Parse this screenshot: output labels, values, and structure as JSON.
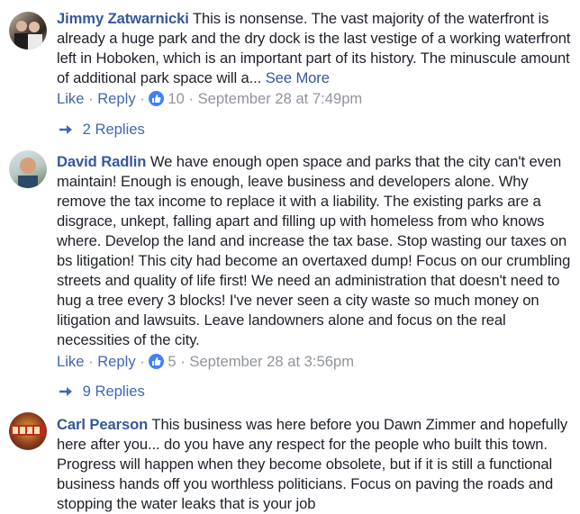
{
  "comments": [
    {
      "author": "Jimmy Zatwarnicki",
      "text": "This is nonsense. The vast majority of the waterfront is already a huge park and the dry dock is the last vestige of a working waterfront left in Hoboken, which is an important part of its history. The minuscule amount of additional park space will a...",
      "see_more": "See More",
      "like_label": "Like",
      "reply_label": "Reply",
      "reactions": "10",
      "timestamp": "September 28 at 7:49pm",
      "replies_label": "2 Replies",
      "avatar_icon": "profile-photo-icon"
    },
    {
      "author": "David Radlin",
      "text": "We have enough open space and parks that the city can't even maintain! Enough is enough, leave business and developers alone. Why remove the tax income to replace it with a liability. The existing parks are a disgrace, unkept, falling apart and filling up with homeless from who knows where. Develop the land and increase the tax base. Stop wasting our taxes on bs litigation! This city had become an overtaxed dump! Focus on our crumbling streets and quality of life first! We need an administration that doesn't need to hug a tree every 3 blocks! I've never seen a city waste so much money on litigation and lawsuits. Leave landowners alone and focus on the real necessities of the city.",
      "like_label": "Like",
      "reply_label": "Reply",
      "reactions": "5",
      "timestamp": "September 28 at 3:56pm",
      "replies_label": "9 Replies",
      "avatar_icon": "profile-photo-icon"
    },
    {
      "author": "Carl Pearson",
      "text": "This business was here before you Dawn Zimmer and hopefully here after you... do you have any respect for the people who built this town. Progress will happen when they become obsolete, but if it is still a functional business hands off you worthless politicians. Focus on paving the roads and stopping the water leaks that is your job",
      "avatar_icon": "profile-photo-icon"
    }
  ],
  "separator": " · ",
  "colors": {
    "link": "#365899",
    "action_link": "#4267b2",
    "meta": "#90949c",
    "text": "#1d2129",
    "like_badge": "#4080ff"
  }
}
